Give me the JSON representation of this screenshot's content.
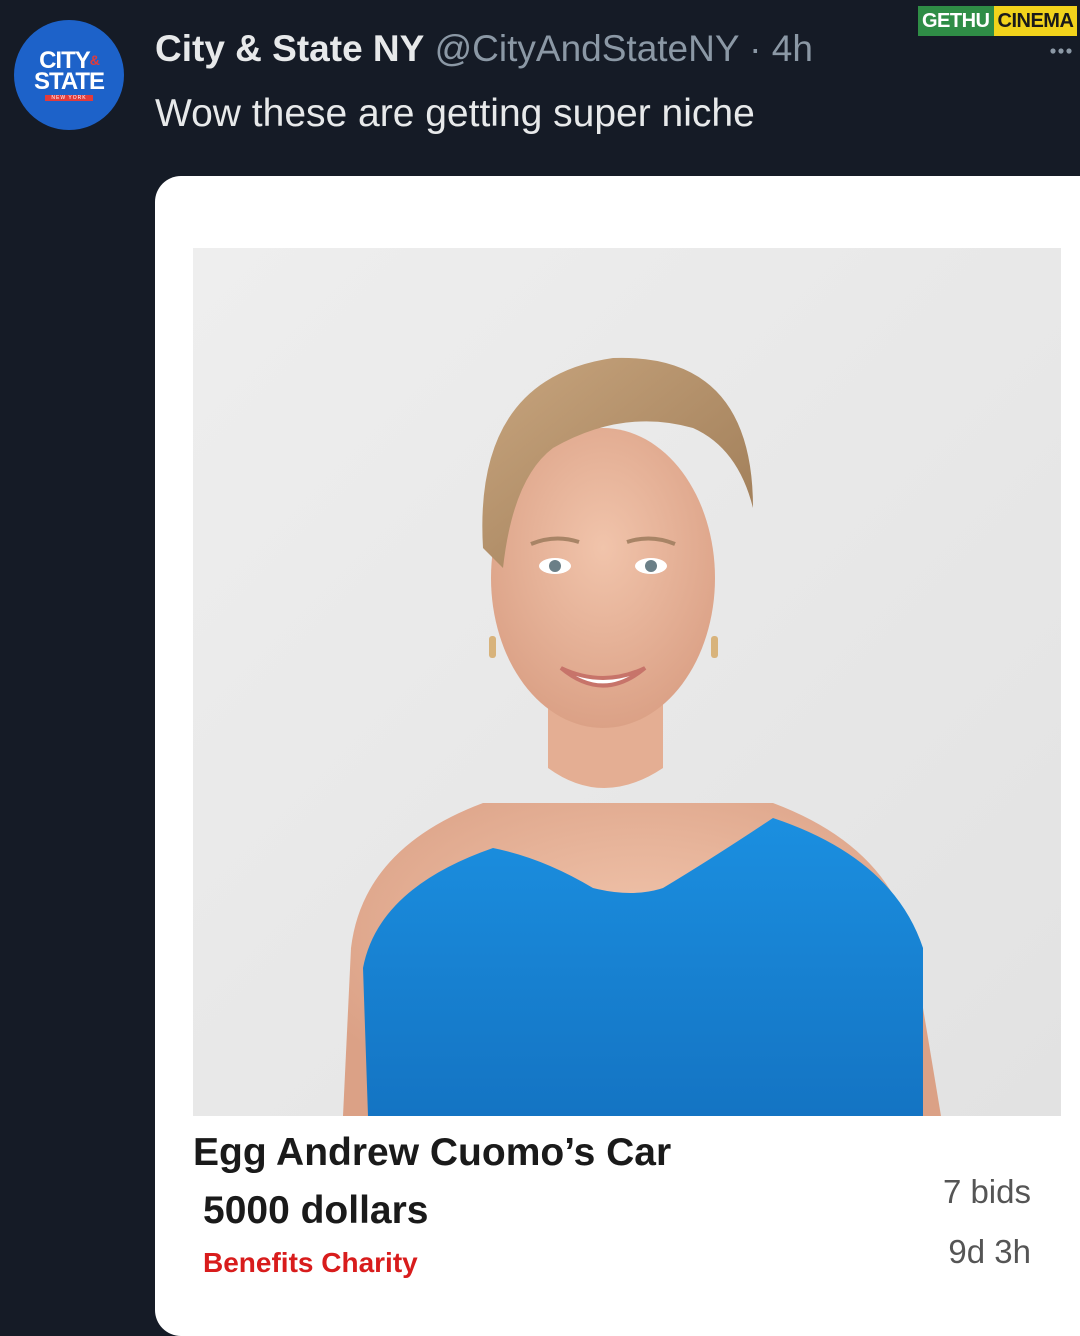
{
  "tweet": {
    "avatar": {
      "name": "city-and-state-logo",
      "line1": "CITY",
      "amp": "&",
      "line2": "STATE",
      "sub": "NEW YORK",
      "color": "#1d62c9"
    },
    "display_name": "City & State NY",
    "handle": "@CityAndStateNY",
    "separator": "·",
    "time": "4h",
    "text": "Wow these are getting super niche",
    "more_icon": "more-dots-icon"
  },
  "watermark": {
    "part1": "GETHU",
    "part2": "CINEMA",
    "colors": [
      "#2f8d46",
      "#f2d31b"
    ]
  },
  "listing": {
    "photo": "portrait of a smiling woman with short blonde hair wearing a blue sleeveless top",
    "title": "Egg Andrew Cuomo’s Car",
    "price": "5000 dollars",
    "tag": "Benefits Charity",
    "tag_color": "#d81c1c",
    "bids": "7 bids",
    "time_left": "9d 3h"
  },
  "colors": {
    "background": "#151b26",
    "text_primary": "#e7e9ea",
    "text_secondary": "#8b98a5",
    "top_color": "#1a7fd4"
  }
}
